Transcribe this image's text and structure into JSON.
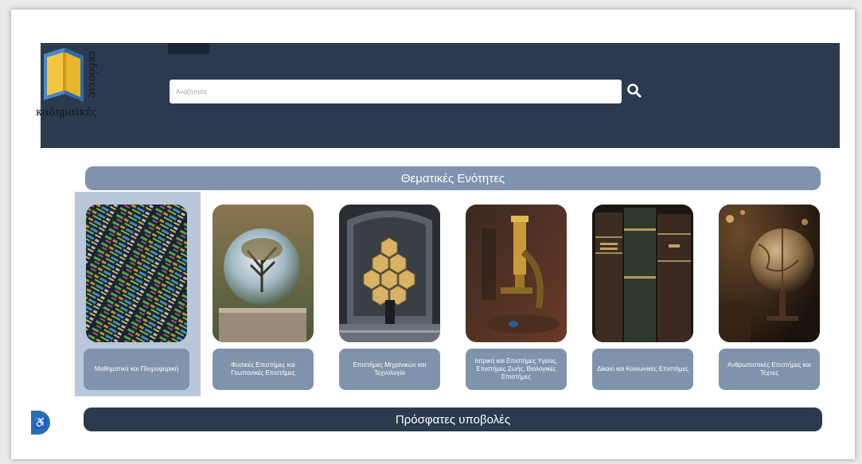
{
  "brand": {
    "logo_vertical_text": "εκδόσεις",
    "logo_word": "καδημαϊκές"
  },
  "search": {
    "placeholder": "Αναζήτηση",
    "button_icon": "search-icon"
  },
  "themes": {
    "title": "Θεματικές Ενότητες",
    "cards": [
      {
        "label": "Μαθηματικά και Πληροφορική",
        "image": "code-screen-image",
        "selected": true
      },
      {
        "label": "Φυσικές Επιστήμες και Γεωπονικές Επιστήμες",
        "image": "crystal-ball-tree-image",
        "selected": false
      },
      {
        "label": "Επιστήμες Μηχανικών και Τεχνολογία",
        "image": "telescope-mirror-image",
        "selected": false
      },
      {
        "label": "Ιατρική και Επιστήμες Υγείας, Επιστήμες Ζωής, Βιολογικές Επιστήμες",
        "image": "microscope-image",
        "selected": false
      },
      {
        "label": "Δίκαιο και Κοινωνικές Επιστήμες",
        "image": "law-books-image",
        "selected": false
      },
      {
        "label": "Ανθρωπιστικές Επιστήμες και Τέχνες",
        "image": "antique-globe-image",
        "selected": false
      }
    ]
  },
  "recent": {
    "title": "Πρόσφατες υποβολές"
  },
  "accessibility": {
    "icon": "accessibility-icon",
    "symbol": "♿"
  },
  "colors": {
    "header_bg": "#2c3a4f",
    "accent": "#7f93ad",
    "selected_card_bg": "#b9c7db"
  }
}
